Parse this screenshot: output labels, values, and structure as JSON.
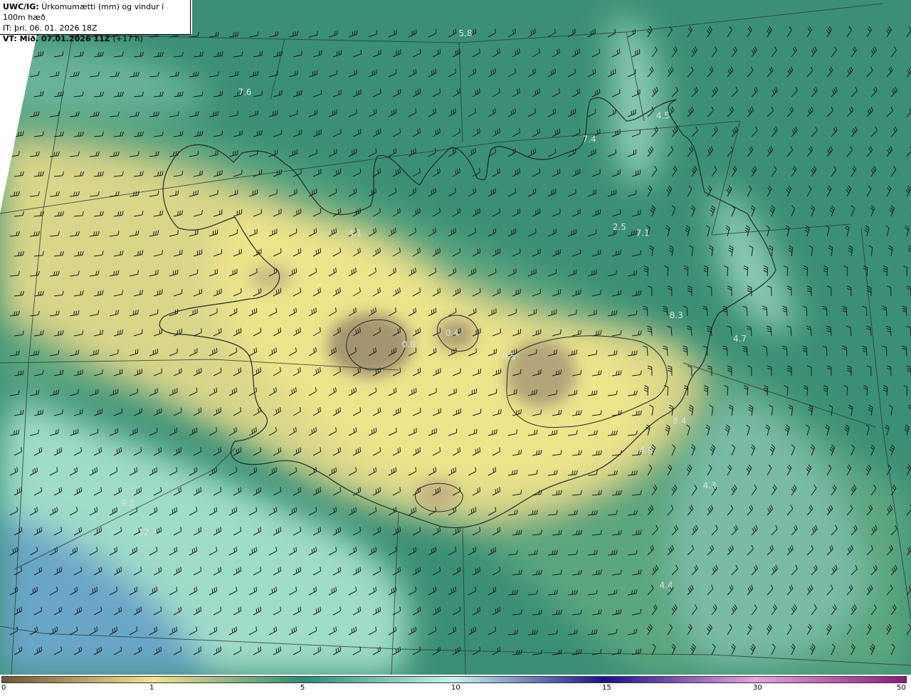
{
  "header": {
    "model": "UWC/IG:",
    "description": "Úrkomumætti (mm) og vindur í 100m hæð",
    "it_label": "IT:",
    "it_value": "þri. 06. 01. 2026 18Z",
    "vt_label": "VT:",
    "vt_value": "Mið. 07.01.2026 11Z",
    "vt_offset": "(+17 h)"
  },
  "colorbar": {
    "ticks": [
      {
        "label": "0",
        "value": 0
      },
      {
        "label": "1",
        "value": 1
      },
      {
        "label": "5",
        "value": 5
      },
      {
        "label": "10",
        "value": 10
      },
      {
        "label": "15",
        "value": 15
      },
      {
        "label": "30",
        "value": 30
      },
      {
        "label": "50",
        "value": 50
      }
    ],
    "colors": {
      "c0": "#6b5636",
      "c1": "#f1e48e",
      "c5": "#2e8a74",
      "c10": "#c9f4ee",
      "c15": "#1a1088",
      "c30": "#e9a2dc",
      "c50": "#8a1a7a"
    }
  },
  "map_labels": [
    {
      "text": "5.8",
      "lon": -18.2,
      "lat": 67.6
    },
    {
      "text": "7.6",
      "lon": -24.8,
      "lat": 67.1
    },
    {
      "text": "4.5",
      "lon": -12.3,
      "lat": 66.9
    },
    {
      "text": "7.4",
      "lon": -14.5,
      "lat": 66.7
    },
    {
      "text": "2.5",
      "lon": -13.6,
      "lat": 65.95
    },
    {
      "text": "7.1",
      "lon": -12.9,
      "lat": 65.9
    },
    {
      "text": "4.1",
      "lon": -21.5,
      "lat": 65.9
    },
    {
      "text": "8.3",
      "lon": -11.9,
      "lat": 65.2
    },
    {
      "text": "4.7",
      "lon": -10.0,
      "lat": 65.0
    },
    {
      "text": "0.8",
      "lon": -19.9,
      "lat": 64.95
    },
    {
      "text": "0.4",
      "lon": -18.6,
      "lat": 65.05
    },
    {
      "text": "0.5",
      "lon": -16.9,
      "lat": 64.85
    },
    {
      "text": "8.4",
      "lon": -11.8,
      "lat": 64.3
    },
    {
      "text": "4.9",
      "lon": -12.8,
      "lat": 64.05
    },
    {
      "text": "4.3",
      "lon": -10.9,
      "lat": 63.75
    },
    {
      "text": "9.8",
      "lon": -28.3,
      "lat": 63.6
    },
    {
      "text": "12.3",
      "lon": -27.7,
      "lat": 63.35
    },
    {
      "text": "4.4",
      "lon": -12.2,
      "lat": 62.9
    }
  ]
}
